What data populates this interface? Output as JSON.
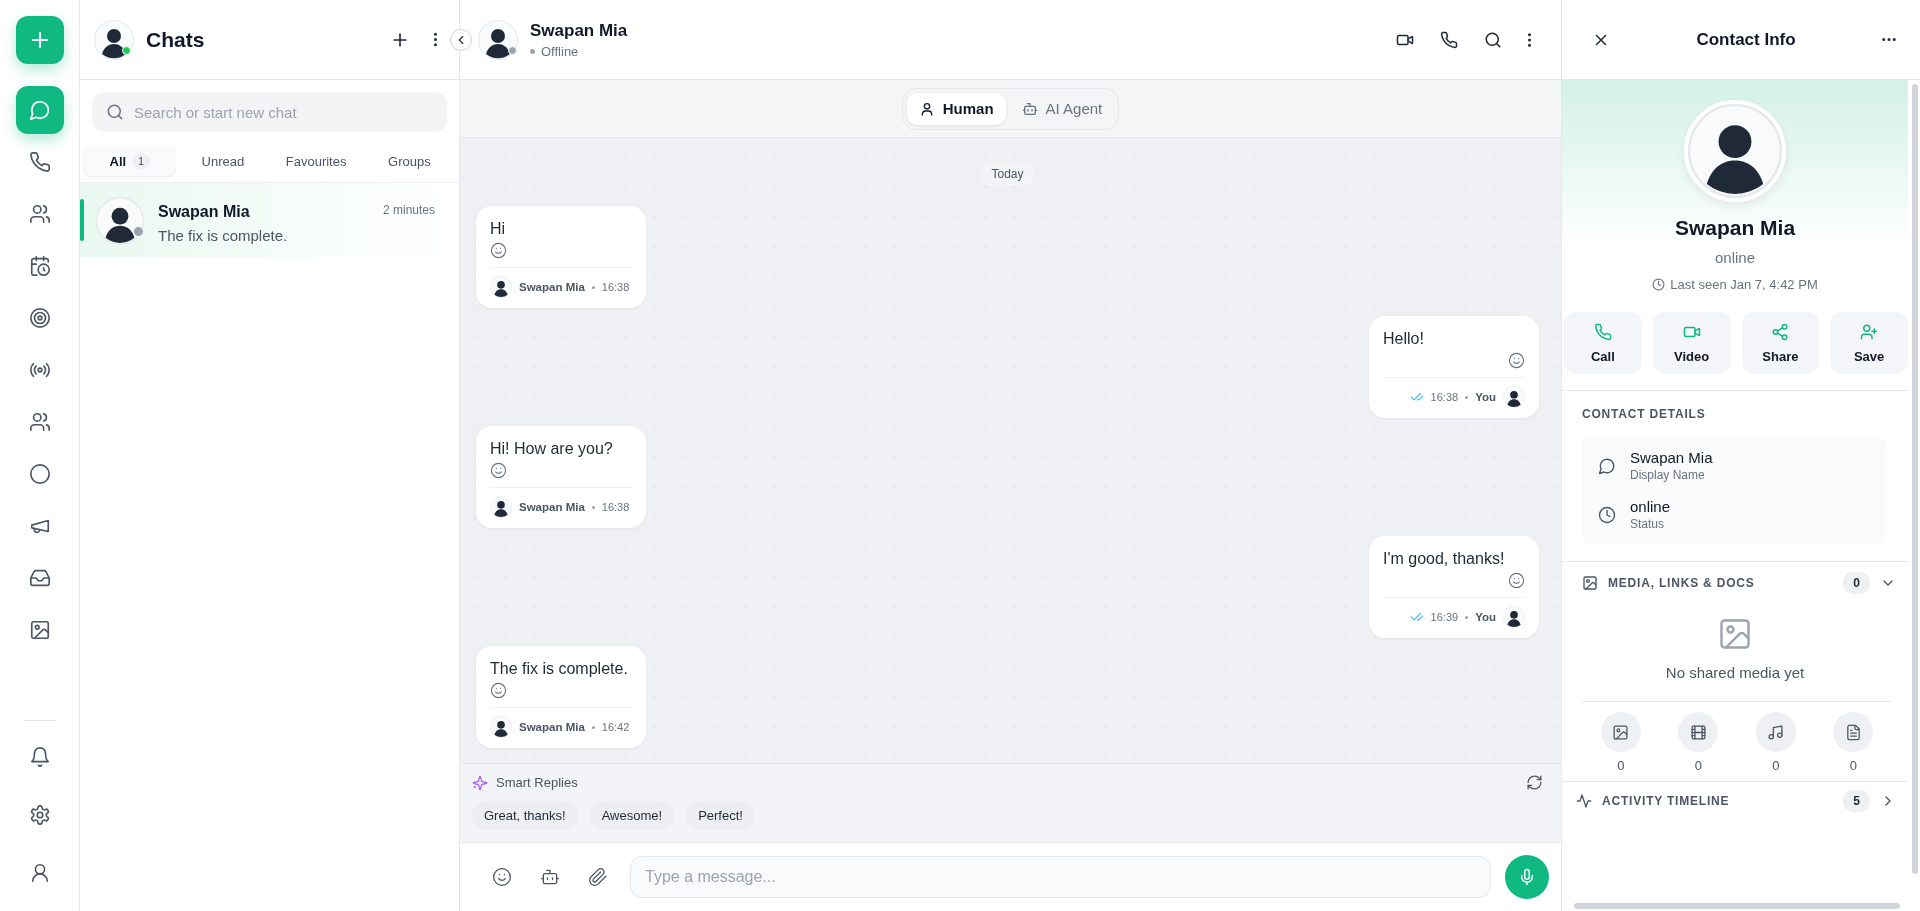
{
  "rail": {
    "items": [
      {
        "kind": "chat",
        "selected": true
      },
      {
        "kind": "phone",
        "selected": false
      },
      {
        "kind": "contacts",
        "selected": false
      },
      {
        "kind": "schedule",
        "selected": false
      },
      {
        "kind": "target",
        "selected": false
      },
      {
        "kind": "broadcast",
        "selected": false
      },
      {
        "kind": "team",
        "selected": false
      },
      {
        "kind": "status",
        "selected": false
      },
      {
        "kind": "campaign",
        "selected": false
      },
      {
        "kind": "inbox",
        "selected": false
      },
      {
        "kind": "gallery",
        "selected": false
      }
    ],
    "bottom_items": [
      {
        "kind": "notifications",
        "selected": false
      },
      {
        "kind": "settings",
        "selected": false
      },
      {
        "kind": "profile",
        "selected": false
      }
    ]
  },
  "chat_list": {
    "title": "Chats",
    "online": true,
    "search": {
      "placeholder": "Search or start new chat"
    },
    "tabs": [
      {
        "label": "All",
        "count": "1",
        "selected": true
      },
      {
        "label": "Unread",
        "selected": false
      },
      {
        "label": "Favourites",
        "selected": false
      },
      {
        "label": "Groups",
        "selected": false
      }
    ],
    "chats": [
      {
        "name": "Swapan Mia",
        "time": "2 minutes",
        "preview": "The fix is complete.",
        "online": false,
        "selected": true
      }
    ]
  },
  "conversation": {
    "name": "Swapan Mia",
    "status": "Offline",
    "online": false,
    "modes": [
      {
        "kind": "human",
        "label": "Human",
        "selected": true
      },
      {
        "kind": "agent",
        "label": "AI Agent",
        "selected": false
      }
    ],
    "date": "Today",
    "messages": [
      {
        "kind": "incoming",
        "text": "Hi",
        "sender": "Swapan Mia",
        "time": "16:38"
      },
      {
        "kind": "outgoing",
        "text": "Hello!",
        "sender": "You",
        "time": "16:38",
        "read": true
      },
      {
        "kind": "incoming",
        "text": "Hi! How are you?",
        "sender": "Swapan Mia",
        "time": "16:38"
      },
      {
        "kind": "outgoing",
        "text": "I'm good, thanks!",
        "sender": "You",
        "time": "16:39",
        "read": true
      },
      {
        "kind": "incoming",
        "text": "The fix is complete.",
        "sender": "Swapan Mia",
        "time": "16:42"
      }
    ],
    "smart_replies": {
      "title": "Smart Replies",
      "items": [
        "Great, thanks!",
        "Awesome!",
        "Perfect!"
      ]
    },
    "composer": {
      "placeholder": "Type a message..."
    }
  },
  "contact_info": {
    "title": "Contact Info",
    "name": "Swapan Mia",
    "status": "online",
    "last_seen": "Last seen Jan 7, 4:42 PM",
    "actions": [
      {
        "kind": "call",
        "label": "Call"
      },
      {
        "kind": "video",
        "label": "Video"
      },
      {
        "kind": "share",
        "label": "Share"
      },
      {
        "kind": "save",
        "label": "Save"
      }
    ],
    "details_heading": "CONTACT DETAILS",
    "details": [
      {
        "kind": "name",
        "value": "Swapan Mia",
        "label": "Display Name"
      },
      {
        "kind": "status",
        "value": "online",
        "label": "Status"
      }
    ],
    "media": {
      "heading": "MEDIA, LINKS & DOCS",
      "count": "0",
      "empty": "No shared media yet",
      "counts": [
        {
          "kind": "images",
          "count": "0"
        },
        {
          "kind": "videos",
          "count": "0"
        },
        {
          "kind": "audio",
          "count": "0"
        },
        {
          "kind": "documents",
          "count": "0"
        }
      ]
    },
    "activity": {
      "heading": "ACTIVITY TIMELINE",
      "count": "5"
    }
  }
}
